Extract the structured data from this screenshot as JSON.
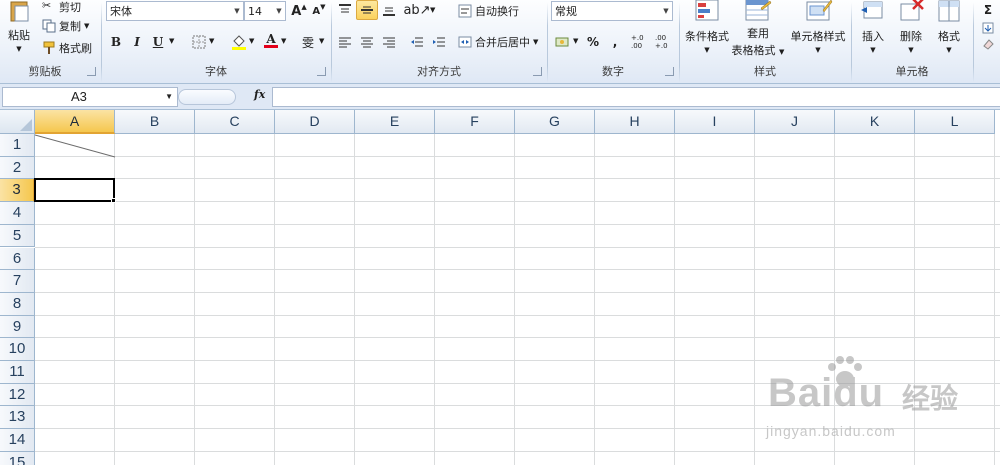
{
  "ribbon": {
    "clipboard": {
      "paste_label": "粘贴",
      "cut_label": "剪切",
      "copy_label": "复制",
      "format_painter_label": "格式刷",
      "group_label": "剪贴板"
    },
    "font": {
      "font_name": "宋体",
      "font_size": "14",
      "grow_label": "A",
      "shrink_label": "A",
      "bold_label": "B",
      "italic_label": "I",
      "underline_label": "U",
      "font_color_label": "A",
      "phonetic_label": "雯",
      "group_label": "字体"
    },
    "alignment": {
      "wrap_text_label": "自动换行",
      "merge_center_label": "合并后居中",
      "group_label": "对齐方式"
    },
    "number": {
      "format_value": "常规",
      "percent_label": "%",
      "comma_label": ",",
      "increase_decimal_label": "+.0 .00",
      "decrease_decimal_label": ".00 +.0",
      "group_label": "数字"
    },
    "styles": {
      "conditional_format_label": "条件格式",
      "table_format_line1": "套用",
      "table_format_line2": "表格格式",
      "cell_styles_label": "单元格样式",
      "group_label": "样式"
    },
    "cells": {
      "insert_label": "插入",
      "delete_label": "删除",
      "format_label": "格式",
      "group_label": "单元格"
    }
  },
  "formula_bar": {
    "name_box": "A3",
    "fx_label": "fx",
    "formula_value": ""
  },
  "sheet": {
    "columns": [
      "A",
      "B",
      "C",
      "D",
      "E",
      "F",
      "G",
      "H",
      "I",
      "J",
      "K",
      "L"
    ],
    "rows": [
      "1",
      "2",
      "3",
      "4",
      "5",
      "6",
      "7",
      "8",
      "9",
      "10",
      "11",
      "12",
      "13",
      "14",
      "15"
    ],
    "selected_column": "A",
    "selected_row": "3",
    "active_cell": "A3"
  },
  "watermark": {
    "logo_text": "Baidu",
    "brand_text": "经验",
    "url_text": "jingyan.baidu.com"
  },
  "colors": {
    "ribbon_bg": "#dfe8f5",
    "header_selected": "#f5c74e",
    "gridline": "#dadcdd",
    "header_border": "#9eb6ce"
  }
}
